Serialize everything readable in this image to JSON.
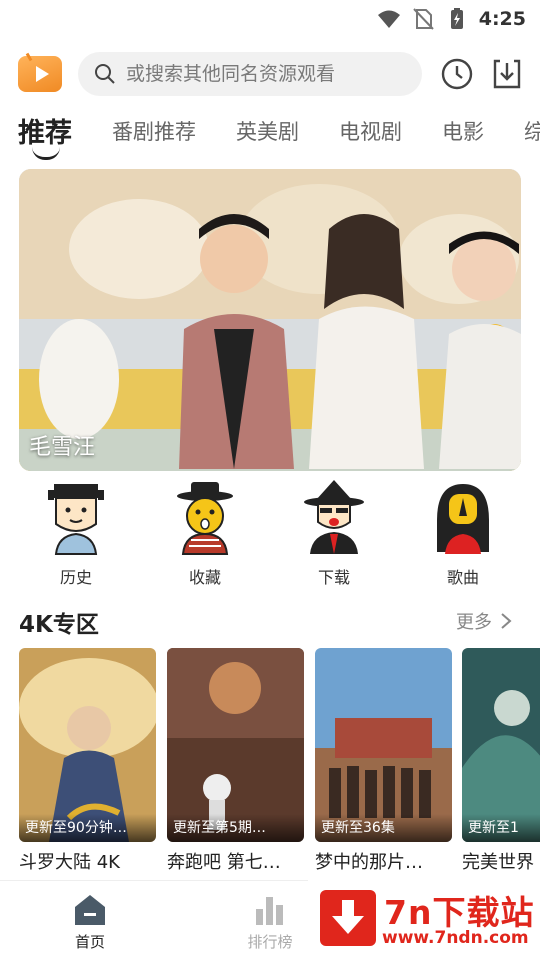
{
  "status_bar": {
    "time": "4:25"
  },
  "header": {
    "search_placeholder": "或搜索其他同名资源观看"
  },
  "tabs": [
    {
      "label": "推荐",
      "active": true
    },
    {
      "label": "番剧推荐"
    },
    {
      "label": "英美剧"
    },
    {
      "label": "电视剧"
    },
    {
      "label": "电影"
    },
    {
      "label": "综"
    }
  ],
  "banner": {
    "caption": "毛雪汪"
  },
  "quick_nav": [
    {
      "label": "历史",
      "icon": "history-character-icon"
    },
    {
      "label": "收藏",
      "icon": "favorites-character-icon"
    },
    {
      "label": "下载",
      "icon": "download-character-icon"
    },
    {
      "label": "歌曲",
      "icon": "songs-character-icon"
    }
  ],
  "section_4k": {
    "title": "4K专区",
    "more": "更多",
    "items": [
      {
        "badge": "更新至90分钟…",
        "title": "斗罗大陆 4K"
      },
      {
        "badge": "更新至第5期…",
        "title": "奔跑吧 第七…"
      },
      {
        "badge": "更新至36集",
        "title": "梦中的那片…"
      },
      {
        "badge": "更新至1",
        "title": "完美世界"
      }
    ]
  },
  "bottom_nav": [
    {
      "label": "首页",
      "active": true
    },
    {
      "label": "排行榜"
    }
  ],
  "watermark": {
    "title": "7n下载站",
    "url": "www.7ndn.com"
  },
  "colors": {
    "accent": "#f08a24",
    "watermark": "#e0261c",
    "text": "#222222"
  }
}
